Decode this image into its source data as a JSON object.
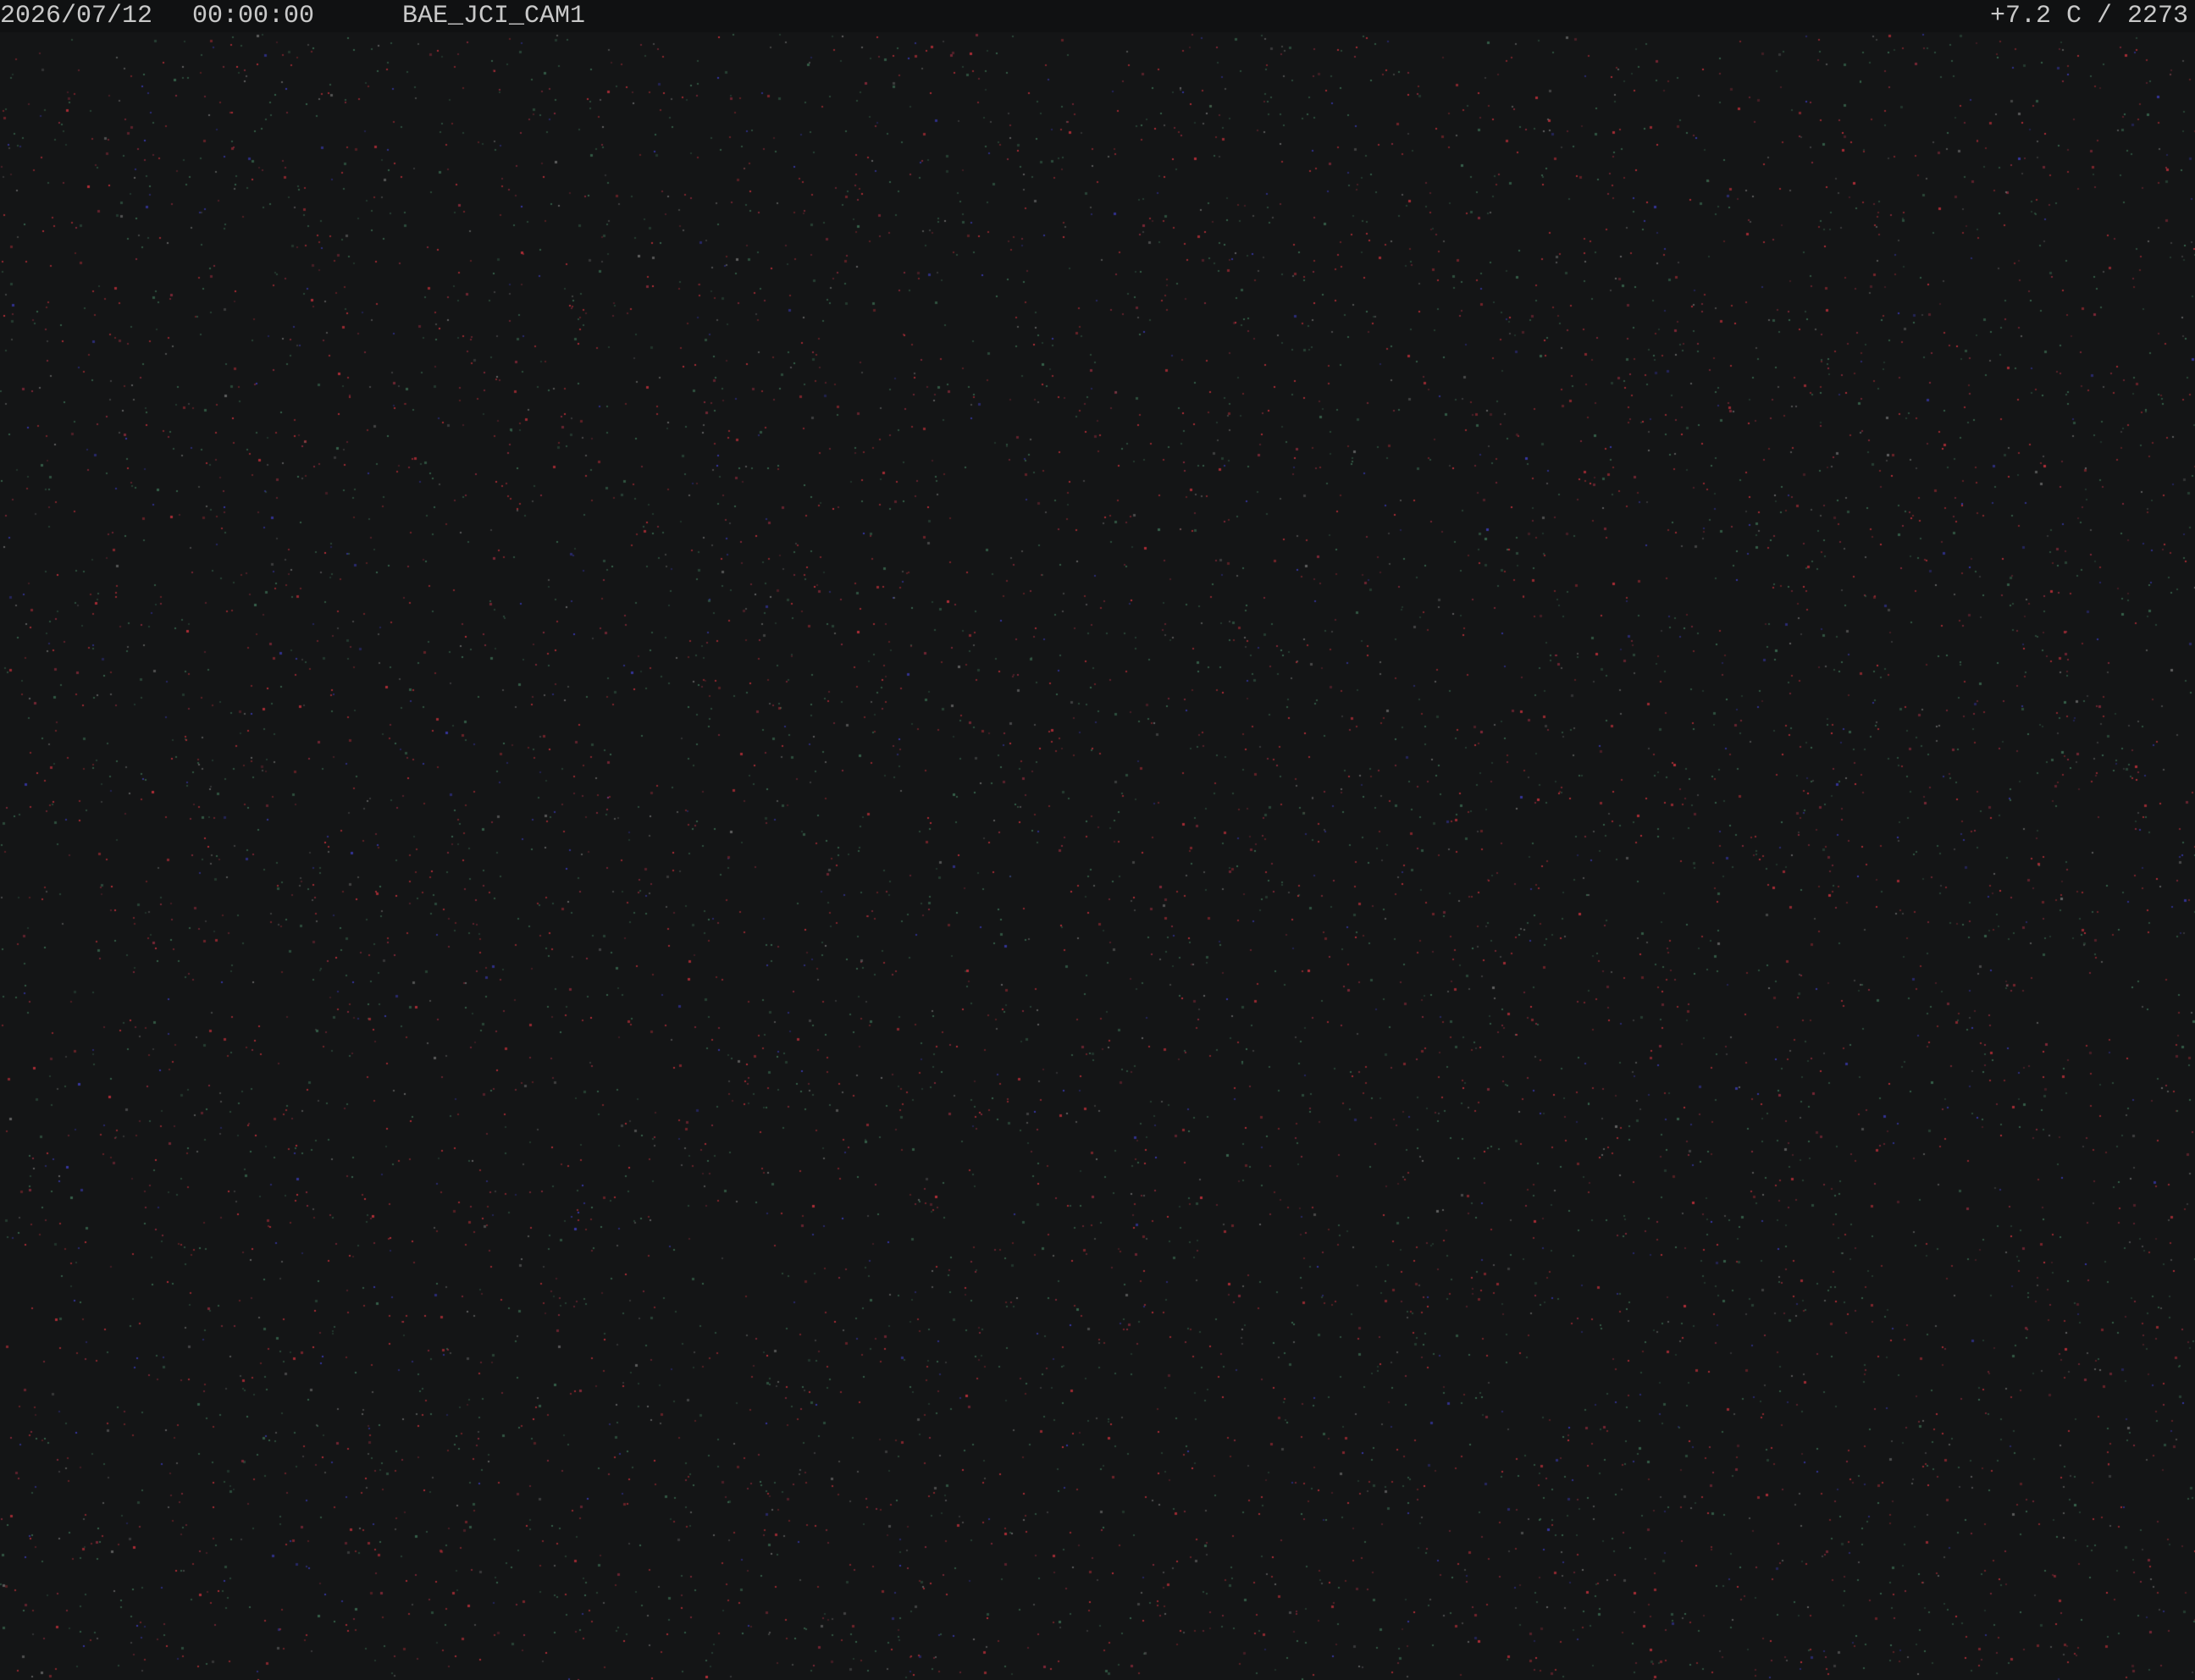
{
  "overlay": {
    "date": "2026/07/12",
    "time": "00:00:00",
    "camera_name": "BAE_JCI_CAM1",
    "temperature_exposure": "+7.2 C / 2273"
  },
  "image": {
    "description_type": "night-sky-sensor-noise",
    "background_color": "#141516",
    "noise_colors": [
      "#c0303a",
      "#8a2a3a",
      "#3a6a50",
      "#3a3ab0",
      "#6a6a6a"
    ]
  }
}
